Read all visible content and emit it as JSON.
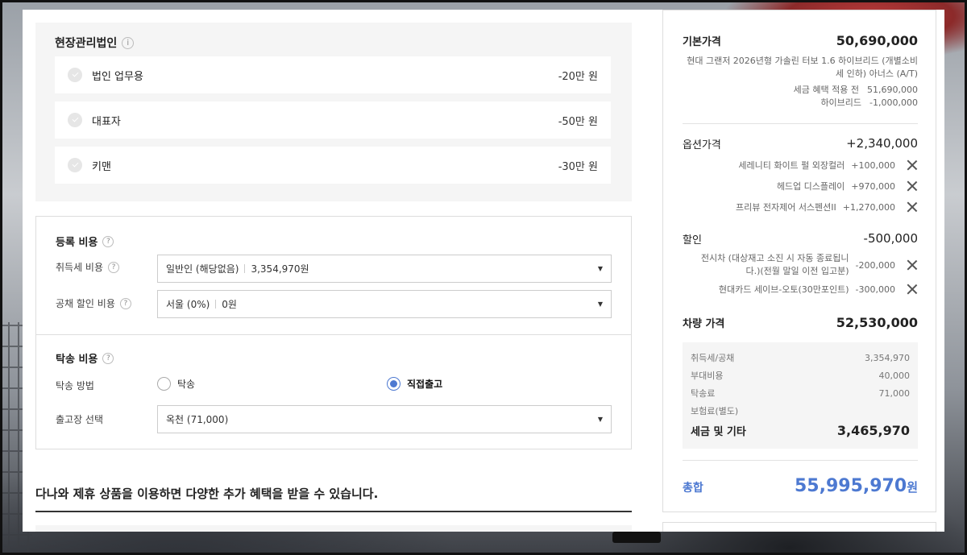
{
  "corporate": {
    "title": "현장관리법인",
    "items": [
      {
        "label": "법인 업무용",
        "amount": "-20만 원"
      },
      {
        "label": "대표자",
        "amount": "-50만 원"
      },
      {
        "label": "키맨",
        "amount": "-30만 원"
      }
    ]
  },
  "registration": {
    "title": "등록 비용",
    "acquisition_label": "취득세 비용",
    "acquisition_value": "일반인 (해당없음)",
    "acquisition_amount": "3,354,970원",
    "bond_label": "공채 할인 비용",
    "bond_value": "서울 (0%)",
    "bond_amount": "0원"
  },
  "delivery": {
    "title": "탁송 비용",
    "method_label": "탁송 방법",
    "option_delivery": "탁송",
    "option_direct": "직접출고",
    "selected": "직접출고",
    "location_label": "출고장 선택",
    "location_value": "옥천 (71,000)"
  },
  "promo": {
    "title": "다나와 제휴 상품을 이용하면 다양한 추가 혜택을 받을 수 있습니다."
  },
  "summary": {
    "base_label": "기본가격",
    "base_value": "50,690,000",
    "model_desc": "현대 그랜저 2026년형 가솔린 터보 1.6 하이브리드 (개별소비세 인하) 아너스 (A/T)",
    "pretax_label": "세금 혜택 적용 전",
    "pretax_value": "51,690,000",
    "hybrid_label": "하이브리드",
    "hybrid_value": "-1,000,000",
    "options_label": "옵션가격",
    "options_value": "+2,340,000",
    "options": [
      {
        "name": "세레니티 화이트 펄 외장컬러",
        "price": "+100,000"
      },
      {
        "name": "헤드업 디스플레이",
        "price": "+970,000"
      },
      {
        "name": "프리뷰 전자제어 서스펜션II",
        "price": "+1,270,000"
      }
    ],
    "discount_label": "할인",
    "discount_value": "-500,000",
    "discounts": [
      {
        "name": "전시차 (대상재고 소진 시 자동 종료됩니다.)(전월 말일 이전 입고분)",
        "price": "-200,000"
      },
      {
        "name": "현대카드 세이브-오토(30만포인트)",
        "price": "-300,000"
      }
    ],
    "car_price_label": "차량 가격",
    "car_price_value": "52,530,000",
    "taxes": [
      {
        "label": "취득세/공채",
        "value": "3,354,970"
      },
      {
        "label": "부대비용",
        "value": "40,000"
      },
      {
        "label": "탁송료",
        "value": "71,000"
      },
      {
        "label": "보험료(별도)",
        "value": ""
      }
    ],
    "tax_total_label": "세금 및 기타",
    "tax_total_value": "3,465,970",
    "total_label": "총합",
    "total_value": "55,995,970",
    "total_unit": "원"
  }
}
